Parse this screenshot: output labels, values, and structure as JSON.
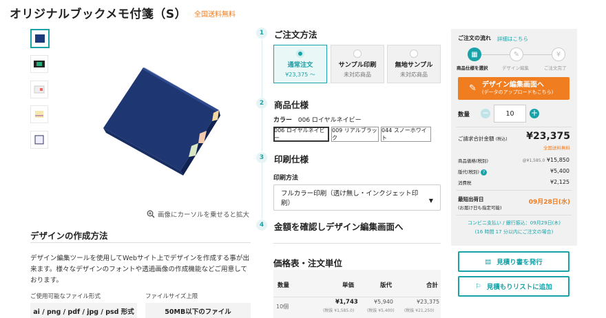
{
  "product": {
    "title": "オリジナルブックメモ付箋（S）",
    "free_shipping": "全国送料無料"
  },
  "gallery": {
    "zoom_hint": "画像にカーソルを乗せると拡大",
    "thumbnails": [
      "navy-cover",
      "open-dark",
      "white-open",
      "tabs",
      "outline"
    ]
  },
  "design_method": {
    "heading": "デザインの作成方法",
    "description": "デザイン編集ツールを使用してWebサイト上でデザインを作成する事が出来ます。様々なデザインのフォントや透過画像の作成機能などご用意しております。",
    "formats_label": "ご使用可能なファイル形式",
    "formats_value": "ai / png / pdf / jpg / psd 形式",
    "size_label": "ファイルサイズ上限",
    "size_value": "50MB以下のファイル"
  },
  "steps": [
    {
      "num": "1",
      "label": "ご注文方法"
    },
    {
      "num": "2",
      "label": "商品仕様"
    },
    {
      "num": "3",
      "label": "印刷仕様"
    },
    {
      "num": "4",
      "label": "金額を確認しデザイン編集画面へ"
    }
  ],
  "order_methods": [
    {
      "title": "通常注文",
      "sub": "¥23,375 〜",
      "selected": true
    },
    {
      "title": "サンプル印刷",
      "sub": "未対応商品",
      "selected": false
    },
    {
      "title": "無地サンプル",
      "sub": "未対応商品",
      "selected": false
    }
  ],
  "color": {
    "label": "カラー",
    "selected": "006 ロイヤルネイビー",
    "options": [
      "006 ロイヤルネイビー",
      "009 リアルブラック",
      "044 スノーホワイト"
    ]
  },
  "print": {
    "label": "印刷方法",
    "value": "フルカラー印刷（透け無し・インクジェット印刷）"
  },
  "price_table": {
    "heading": "価格表・注文単位",
    "headers": [
      "数量",
      "単価",
      "版代",
      "合計"
    ],
    "row": {
      "qty": "10個",
      "unit": "¥1,743",
      "unit_sub": "(税抜 ¥1,585.0)",
      "plate": "¥5,940",
      "plate_sub": "(税抜 ¥5,400)",
      "total": "¥23,375",
      "total_sub": "(税抜 ¥21,250)"
    }
  },
  "panel": {
    "flow_title": "ご注文の流れ",
    "flow_link": "詳細はこちら",
    "flow_steps": [
      "商品仕様を選択",
      "デザイン編集",
      "ご注文完了"
    ],
    "design_button": "デザイン編集画面へ",
    "design_button_sub": "(データのアップロードもこちら)",
    "qty_label": "数量",
    "qty_value": "10",
    "total_label": "ご請求合計金額",
    "total_tax": "(税込)",
    "total_value": "¥23,375",
    "total_free": "全国送料無料",
    "product_price_label": "商品価格(税別)",
    "product_price_unit": "@¥1,585.0",
    "product_price": "¥15,850",
    "plate_label": "版代(税別)",
    "plate_value": "¥5,400",
    "tax_label": "消費税",
    "tax_value": "¥2,125",
    "ship_label": "最短出荷日",
    "ship_sub": "(お届け日も指定可能)",
    "ship_date": "09月28日(水)",
    "conv_note": "コンビニ支払い / 銀行振込：09月29日(木)",
    "conv_note2": "(16 時間 17 分以内にご注文の場合)"
  },
  "buttons": {
    "estimate": "見積り書を発行",
    "add_list": "見積もりリストに追加"
  },
  "colors": {
    "accent": "#19a3a9",
    "orange": "#f07d1f"
  }
}
